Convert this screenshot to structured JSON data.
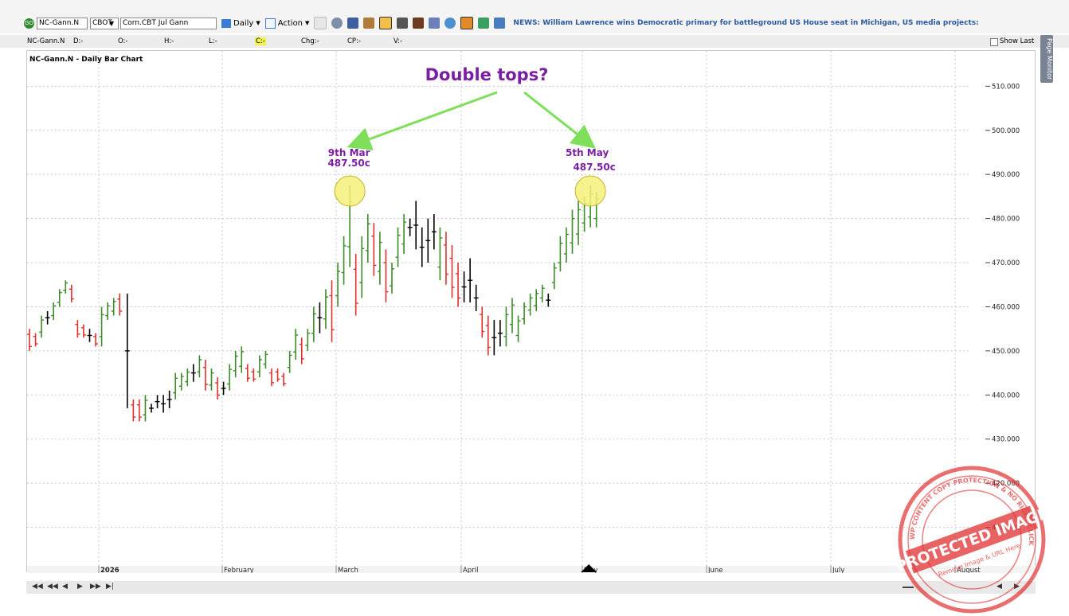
{
  "toolbar": {
    "symbol": "NC-Gann.N",
    "exchange": "CBOT",
    "contract_name": "Corn.CBT Jul Gann",
    "interval_label": "Daily",
    "action_label": "Action",
    "news_ticker": "NEWS: William Lawrence wins Democratic primary for battleground US House seat in Michigan, US media projects:"
  },
  "infobar": {
    "symbol": "NC-Gann.N",
    "date": "D:-",
    "open": "O:-",
    "high": "H:-",
    "low": "L:-",
    "close": "C:-",
    "change": "Chg:-",
    "cp": "CP:-",
    "volume": "V:-",
    "show_last": "Show Last"
  },
  "side_tab": "Page Monitor",
  "colors": {
    "up": "#3c8c28",
    "down": "#e0302c",
    "neutral": "#000000",
    "annotation": "#7b1fa2",
    "arrow": "#7ee05a",
    "highlight": "#f5f07a",
    "stamp": "#e03030"
  },
  "annotations": {
    "headline": "Double tops?",
    "left_date": "9th Mar",
    "left_price": "487.50c",
    "right_date": "5th May",
    "right_price": "487.50c"
  },
  "stamp": {
    "ring_text": "WP CONTENT COPY PROTECTION & NO RIGHT CLICK",
    "center_text": "PROTECTED IMAGE",
    "inner_text": "Remove Image & URL Here"
  },
  "chart_data": {
    "type": "bar",
    "title": "NC-Gann.N - Daily Bar Chart",
    "ylim": [
      400,
      518
    ],
    "y_ticks": [
      410,
      420,
      430,
      440,
      450,
      460,
      470,
      480,
      490,
      500,
      510
    ],
    "y_tick_labels": [
      "410.000",
      "420.000",
      "430.000",
      "440.000",
      "450.000",
      "460.000",
      "470.000",
      "480.000",
      "490.000",
      "500.000",
      "510.000"
    ],
    "x_labels": [
      "2026",
      "February",
      "March",
      "April",
      "May",
      "June",
      "July",
      "August"
    ],
    "grid": true,
    "bars": [
      {
        "h": 455,
        "l": 450,
        "c": "down"
      },
      {
        "h": 454,
        "l": 451,
        "c": "down"
      },
      {
        "h": 458,
        "l": 453,
        "c": "up"
      },
      {
        "h": 459,
        "l": 456,
        "c": "neutral"
      },
      {
        "h": 461,
        "l": 457,
        "c": "up"
      },
      {
        "h": 464,
        "l": 460,
        "c": "up"
      },
      {
        "h": 466,
        "l": 463,
        "c": "up"
      },
      {
        "h": 465,
        "l": 461,
        "c": "down"
      },
      {
        "h": 457,
        "l": 453,
        "c": "down"
      },
      {
        "h": 456,
        "l": 453,
        "c": "down"
      },
      {
        "h": 455,
        "l": 452,
        "c": "neutral"
      },
      {
        "h": 454,
        "l": 451,
        "c": "down"
      },
      {
        "h": 460,
        "l": 451,
        "c": "up"
      },
      {
        "h": 461,
        "l": 457,
        "c": "up"
      },
      {
        "h": 462,
        "l": 458,
        "c": "up"
      },
      {
        "h": 463,
        "l": 458,
        "c": "down"
      },
      {
        "h": 463,
        "l": 437,
        "c": "neutral"
      },
      {
        "h": 439,
        "l": 434,
        "c": "down"
      },
      {
        "h": 439,
        "l": 434,
        "c": "down"
      },
      {
        "h": 440,
        "l": 434,
        "c": "up"
      },
      {
        "h": 438,
        "l": 436,
        "c": "neutral"
      },
      {
        "h": 440,
        "l": 437,
        "c": "neutral"
      },
      {
        "h": 440,
        "l": 436,
        "c": "neutral"
      },
      {
        "h": 441,
        "l": 437,
        "c": "neutral"
      },
      {
        "h": 445,
        "l": 439,
        "c": "up"
      },
      {
        "h": 445,
        "l": 441,
        "c": "up"
      },
      {
        "h": 446,
        "l": 442,
        "c": "up"
      },
      {
        "h": 447,
        "l": 443,
        "c": "neutral"
      },
      {
        "h": 449,
        "l": 444,
        "c": "up"
      },
      {
        "h": 448,
        "l": 441,
        "c": "down"
      },
      {
        "h": 446,
        "l": 441,
        "c": "up"
      },
      {
        "h": 444,
        "l": 439,
        "c": "down"
      },
      {
        "h": 443,
        "l": 440,
        "c": "neutral"
      },
      {
        "h": 447,
        "l": 441,
        "c": "up"
      },
      {
        "h": 450,
        "l": 444,
        "c": "up"
      },
      {
        "h": 451,
        "l": 445,
        "c": "up"
      },
      {
        "h": 447,
        "l": 443,
        "c": "down"
      },
      {
        "h": 446,
        "l": 443,
        "c": "down"
      },
      {
        "h": 449,
        "l": 444,
        "c": "up"
      },
      {
        "h": 450,
        "l": 446,
        "c": "up"
      },
      {
        "h": 446,
        "l": 442,
        "c": "down"
      },
      {
        "h": 446,
        "l": 443,
        "c": "down"
      },
      {
        "h": 445,
        "l": 442,
        "c": "down"
      },
      {
        "h": 450,
        "l": 445,
        "c": "up"
      },
      {
        "h": 455,
        "l": 448,
        "c": "up"
      },
      {
        "h": 453,
        "l": 447,
        "c": "down"
      },
      {
        "h": 455,
        "l": 450,
        "c": "up"
      },
      {
        "h": 460,
        "l": 452,
        "c": "up"
      },
      {
        "h": 461,
        "l": 454,
        "c": "neutral"
      },
      {
        "h": 464,
        "l": 455,
        "c": "up"
      },
      {
        "h": 466,
        "l": 452,
        "c": "down"
      },
      {
        "h": 470,
        "l": 460,
        "c": "up"
      },
      {
        "h": 476,
        "l": 465,
        "c": "up"
      },
      {
        "h": 487.5,
        "l": 469,
        "c": "up"
      },
      {
        "h": 472,
        "l": 458,
        "c": "down"
      },
      {
        "h": 476,
        "l": 462,
        "c": "up"
      },
      {
        "h": 481,
        "l": 470,
        "c": "up"
      },
      {
        "h": 479,
        "l": 467,
        "c": "down"
      },
      {
        "h": 477,
        "l": 465,
        "c": "up"
      },
      {
        "h": 473,
        "l": 461,
        "c": "down"
      },
      {
        "h": 470,
        "l": 463,
        "c": "up"
      },
      {
        "h": 478,
        "l": 469,
        "c": "up"
      },
      {
        "h": 481,
        "l": 472,
        "c": "up"
      },
      {
        "h": 480,
        "l": 476,
        "c": "neutral"
      },
      {
        "h": 484,
        "l": 473,
        "c": "neutral"
      },
      {
        "h": 478,
        "l": 469,
        "c": "neutral"
      },
      {
        "h": 480,
        "l": 470,
        "c": "neutral"
      },
      {
        "h": 481,
        "l": 473,
        "c": "neutral"
      },
      {
        "h": 478,
        "l": 466,
        "c": "up"
      },
      {
        "h": 477,
        "l": 465,
        "c": "down"
      },
      {
        "h": 474,
        "l": 462,
        "c": "down"
      },
      {
        "h": 470,
        "l": 460,
        "c": "down"
      },
      {
        "h": 468,
        "l": 461,
        "c": "neutral"
      },
      {
        "h": 471,
        "l": 461,
        "c": "neutral"
      },
      {
        "h": 465,
        "l": 459,
        "c": "neutral"
      },
      {
        "h": 460,
        "l": 453,
        "c": "down"
      },
      {
        "h": 458,
        "l": 449,
        "c": "down"
      },
      {
        "h": 457,
        "l": 449,
        "c": "neutral"
      },
      {
        "h": 457,
        "l": 451,
        "c": "neutral"
      },
      {
        "h": 460,
        "l": 451,
        "c": "up"
      },
      {
        "h": 462,
        "l": 454,
        "c": "up"
      },
      {
        "h": 458,
        "l": 452,
        "c": "up"
      },
      {
        "h": 461,
        "l": 456,
        "c": "up"
      },
      {
        "h": 463,
        "l": 458,
        "c": "up"
      },
      {
        "h": 464,
        "l": 459,
        "c": "up"
      },
      {
        "h": 465,
        "l": 461,
        "c": "up"
      },
      {
        "h": 463,
        "l": 460,
        "c": "neutral"
      },
      {
        "h": 470,
        "l": 464,
        "c": "up"
      },
      {
        "h": 476,
        "l": 468,
        "c": "up"
      },
      {
        "h": 478,
        "l": 470,
        "c": "up"
      },
      {
        "h": 482,
        "l": 472,
        "c": "up"
      },
      {
        "h": 484,
        "l": 474,
        "c": "up"
      },
      {
        "h": 485,
        "l": 477,
        "c": "up"
      },
      {
        "h": 487.5,
        "l": 478,
        "c": "up"
      },
      {
        "h": 486,
        "l": 478,
        "c": "up"
      }
    ]
  }
}
